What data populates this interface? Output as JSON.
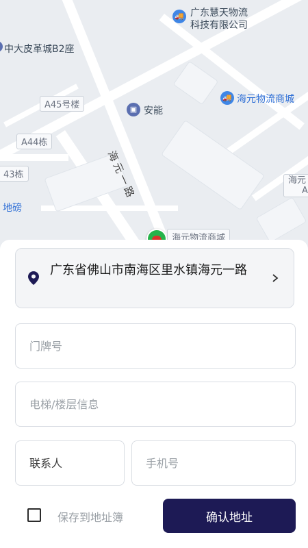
{
  "map": {
    "pois": {
      "huitian_line1": "广东慧天物流",
      "huitian_line2": "科技有限公司",
      "zhongda": "中大皮革城B2座",
      "anneng": "安能",
      "haiyuan_mall": "海元物流商城",
      "haiyuan_mall_pin": "海元物流商城",
      "haiyuan_cut": "海元",
      "haiyuan_cut_a": "A"
    },
    "tags": {
      "a45": "A45号楼",
      "a44": "A44栋",
      "a43": "43栋",
      "dibang": "地磅"
    },
    "road_name": "海元一路"
  },
  "address": {
    "text": "广东省佛山市南海区里水镇海元一路"
  },
  "form": {
    "door_placeholder": "门牌号",
    "floor_placeholder": "电梯/楼层信息",
    "contact_placeholder": "联系人",
    "phone_placeholder": "手机号"
  },
  "footer": {
    "save_label": "保存到地址簿",
    "confirm_label": "确认地址"
  },
  "colors": {
    "confirm_button": "#1d1a55",
    "poi_blue": "#3f86e6"
  }
}
